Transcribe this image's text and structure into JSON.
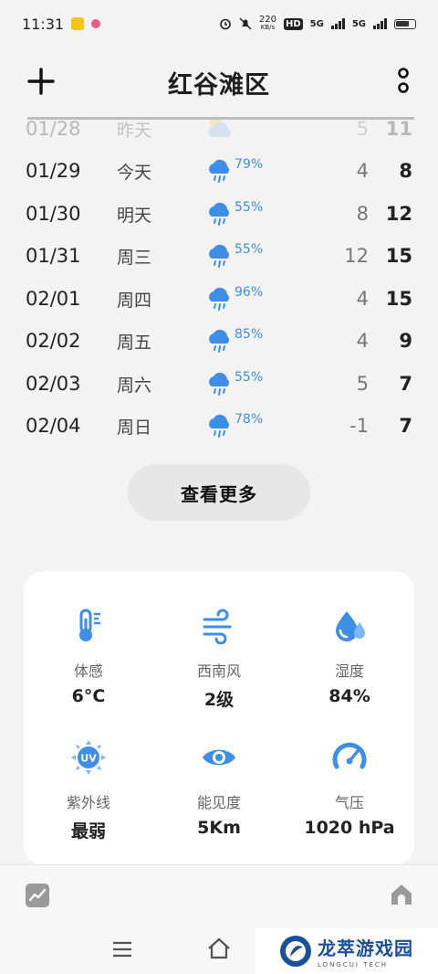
{
  "status_bar": {
    "time": "11:31",
    "speed": "220",
    "speed_unit": "KB/s",
    "hd": "HD",
    "net1": "5G",
    "net2": "5G"
  },
  "header": {
    "title": "红谷滩区"
  },
  "forecast": [
    {
      "date": "01/28",
      "day": "昨天",
      "icon": "partly-cloudy-icon",
      "precip": "",
      "low": "5",
      "high": "11"
    },
    {
      "date": "01/29",
      "day": "今天",
      "icon": "rain-icon",
      "precip": "79%",
      "low": "4",
      "high": "8"
    },
    {
      "date": "01/30",
      "day": "明天",
      "icon": "rain-icon",
      "precip": "55%",
      "low": "8",
      "high": "12"
    },
    {
      "date": "01/31",
      "day": "周三",
      "icon": "rain-icon",
      "precip": "55%",
      "low": "12",
      "high": "15"
    },
    {
      "date": "02/01",
      "day": "周四",
      "icon": "rain-icon",
      "precip": "96%",
      "low": "4",
      "high": "15"
    },
    {
      "date": "02/02",
      "day": "周五",
      "icon": "rain-icon",
      "precip": "85%",
      "low": "4",
      "high": "9"
    },
    {
      "date": "02/03",
      "day": "周六",
      "icon": "rain-icon",
      "precip": "55%",
      "low": "5",
      "high": "7"
    },
    {
      "date": "02/04",
      "day": "周日",
      "icon": "rain-icon",
      "precip": "78%",
      "low": "-1",
      "high": "7"
    }
  ],
  "more_button": "查看更多",
  "details": {
    "feels_like": {
      "label": "体感",
      "value": "6°C",
      "icon": "thermometer-icon"
    },
    "wind": {
      "label": "西南风",
      "value": "2级",
      "icon": "wind-icon"
    },
    "humidity": {
      "label": "湿度",
      "value": "84%",
      "icon": "humidity-drop-icon"
    },
    "uv": {
      "label": "紫外线",
      "value": "最弱",
      "icon": "uv-icon",
      "badge": "UV"
    },
    "visibility": {
      "label": "能见度",
      "value": "5Km",
      "icon": "eye-icon"
    },
    "pressure": {
      "label": "气压",
      "value": "1020 hPa",
      "icon": "gauge-icon"
    }
  },
  "watermark": {
    "cn": "龙萃游戏园",
    "en": "LONGCUI TECH"
  },
  "colors": {
    "accent_blue": "#3e8ee6",
    "background": "#f3f3f3",
    "card": "#ffffff"
  }
}
